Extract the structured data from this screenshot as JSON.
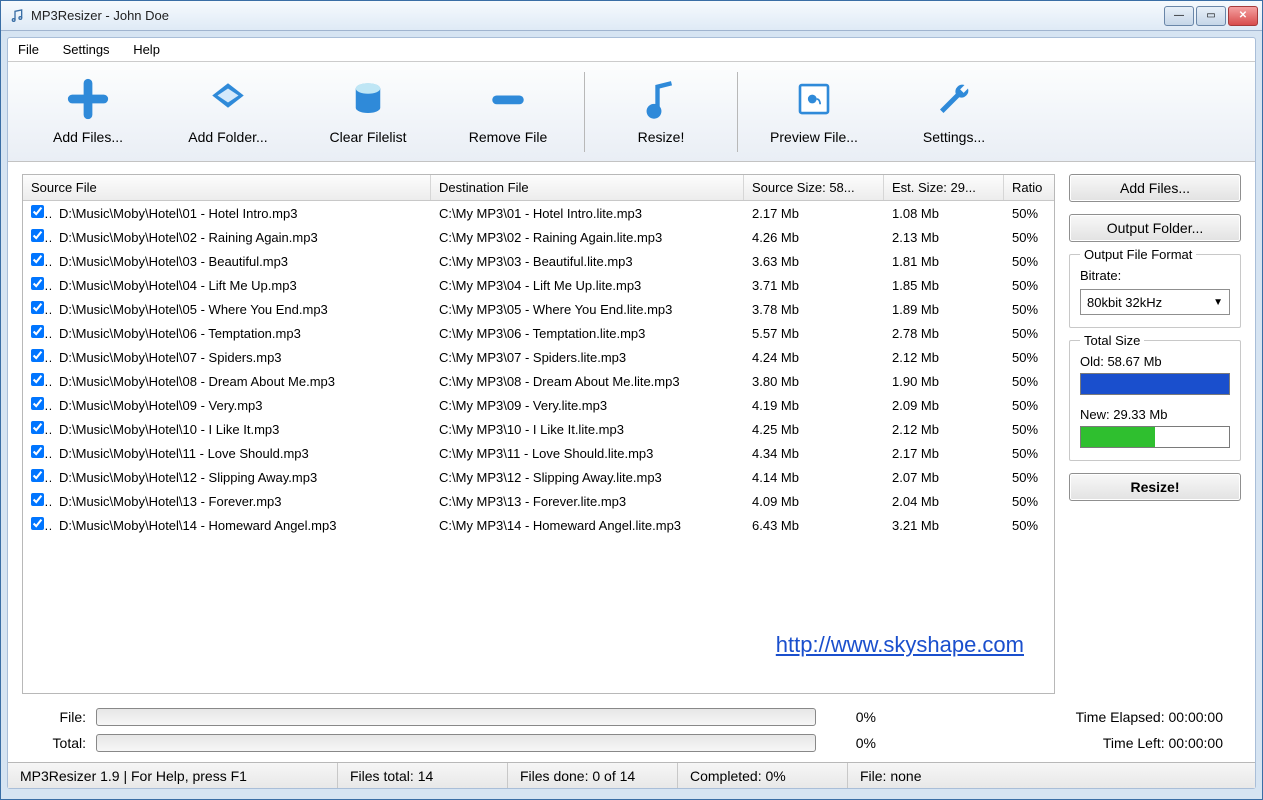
{
  "window": {
    "title": "MP3Resizer - John Doe"
  },
  "menu": {
    "file": "File",
    "settings": "Settings",
    "help": "Help"
  },
  "toolbar": {
    "add_files": "Add Files...",
    "add_folder": "Add Folder...",
    "clear_filelist": "Clear Filelist",
    "remove_file": "Remove File",
    "resize": "Resize!",
    "preview_file": "Preview File...",
    "settings": "Settings..."
  },
  "columns": {
    "source": "Source File",
    "dest": "Destination File",
    "source_size": "Source Size: 58...",
    "est_size": "Est. Size: 29...",
    "ratio": "Ratio"
  },
  "files": [
    {
      "src": "D:\\Music\\Moby\\Hotel\\01 - Hotel Intro.mp3",
      "dst": "C:\\My MP3\\01 - Hotel Intro.lite.mp3",
      "s1": "2.17 Mb",
      "s2": "1.08 Mb",
      "r": "50%"
    },
    {
      "src": "D:\\Music\\Moby\\Hotel\\02 - Raining Again.mp3",
      "dst": "C:\\My MP3\\02 - Raining Again.lite.mp3",
      "s1": "4.26 Mb",
      "s2": "2.13 Mb",
      "r": "50%"
    },
    {
      "src": "D:\\Music\\Moby\\Hotel\\03 - Beautiful.mp3",
      "dst": "C:\\My MP3\\03 - Beautiful.lite.mp3",
      "s1": "3.63 Mb",
      "s2": "1.81 Mb",
      "r": "50%"
    },
    {
      "src": "D:\\Music\\Moby\\Hotel\\04 - Lift Me Up.mp3",
      "dst": "C:\\My MP3\\04 - Lift Me Up.lite.mp3",
      "s1": "3.71 Mb",
      "s2": "1.85 Mb",
      "r": "50%"
    },
    {
      "src": "D:\\Music\\Moby\\Hotel\\05 - Where You End.mp3",
      "dst": "C:\\My MP3\\05 - Where You End.lite.mp3",
      "s1": "3.78 Mb",
      "s2": "1.89 Mb",
      "r": "50%"
    },
    {
      "src": "D:\\Music\\Moby\\Hotel\\06 - Temptation.mp3",
      "dst": "C:\\My MP3\\06 - Temptation.lite.mp3",
      "s1": "5.57 Mb",
      "s2": "2.78 Mb",
      "r": "50%"
    },
    {
      "src": "D:\\Music\\Moby\\Hotel\\07 - Spiders.mp3",
      "dst": "C:\\My MP3\\07 - Spiders.lite.mp3",
      "s1": "4.24 Mb",
      "s2": "2.12 Mb",
      "r": "50%"
    },
    {
      "src": "D:\\Music\\Moby\\Hotel\\08 - Dream About Me.mp3",
      "dst": "C:\\My MP3\\08 - Dream About Me.lite.mp3",
      "s1": "3.80 Mb",
      "s2": "1.90 Mb",
      "r": "50%"
    },
    {
      "src": "D:\\Music\\Moby\\Hotel\\09 - Very.mp3",
      "dst": "C:\\My MP3\\09 - Very.lite.mp3",
      "s1": "4.19 Mb",
      "s2": "2.09 Mb",
      "r": "50%"
    },
    {
      "src": "D:\\Music\\Moby\\Hotel\\10 - I Like It.mp3",
      "dst": "C:\\My MP3\\10 - I Like It.lite.mp3",
      "s1": "4.25 Mb",
      "s2": "2.12 Mb",
      "r": "50%"
    },
    {
      "src": "D:\\Music\\Moby\\Hotel\\11 - Love Should.mp3",
      "dst": "C:\\My MP3\\11 - Love Should.lite.mp3",
      "s1": "4.34 Mb",
      "s2": "2.17 Mb",
      "r": "50%"
    },
    {
      "src": "D:\\Music\\Moby\\Hotel\\12 - Slipping Away.mp3",
      "dst": "C:\\My MP3\\12 - Slipping Away.lite.mp3",
      "s1": "4.14 Mb",
      "s2": "2.07 Mb",
      "r": "50%"
    },
    {
      "src": "D:\\Music\\Moby\\Hotel\\13 - Forever.mp3",
      "dst": "C:\\My MP3\\13 - Forever.lite.mp3",
      "s1": "4.09 Mb",
      "s2": "2.04 Mb",
      "r": "50%"
    },
    {
      "src": "D:\\Music\\Moby\\Hotel\\14 - Homeward Angel.mp3",
      "dst": "C:\\My MP3\\14 - Homeward Angel.lite.mp3",
      "s1": "6.43 Mb",
      "s2": "3.21 Mb",
      "r": "50%"
    }
  ],
  "watermark_url": "http://www.skyshape.com",
  "side": {
    "add_files": "Add Files...",
    "output_folder": "Output Folder...",
    "format_group_title": "Output File Format",
    "bitrate_label": "Bitrate:",
    "bitrate_value": "80kbit 32kHz",
    "totalsize_group_title": "Total Size",
    "old_label": "Old: 58.67 Mb",
    "new_label": "New: 29.33 Mb",
    "resize": "Resize!",
    "new_fill_percent": 50
  },
  "progress": {
    "file_label": "File:",
    "file_pct": "0%",
    "total_label": "Total:",
    "total_pct": "0%",
    "time_elapsed": "Time Elapsed: 00:00:00",
    "time_left": "Time Left: 00:00:00"
  },
  "status": {
    "pane1": "MP3Resizer 1.9 | For Help, press F1",
    "pane2": "Files total: 14",
    "pane3": "Files done: 0 of 14",
    "pane4": "Completed:  0%",
    "pane5": "File: none"
  }
}
